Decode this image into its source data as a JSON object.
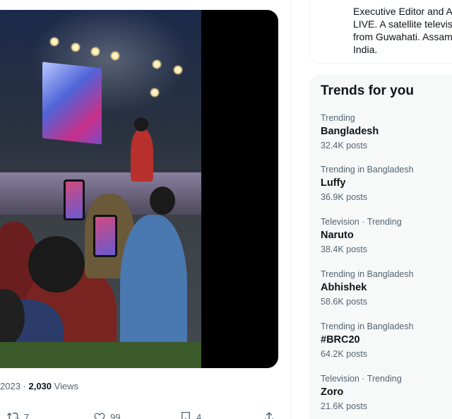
{
  "tweet": {
    "date_fragment": "2023",
    "separator": " · ",
    "views_count": "2,030",
    "views_label": " Views",
    "actions": {
      "retweet_count": "7",
      "like_count": "99",
      "bookmark_count": "4"
    }
  },
  "about": {
    "lines": "Executive Editor and A\nLIVE. A satellite televisi\nfrom Guwahati. Assam\nIndia."
  },
  "trends": {
    "title": "Trends for you",
    "items": [
      {
        "meta": "Trending",
        "name": "Bangladesh",
        "posts": "32.4K posts"
      },
      {
        "meta": "Trending in Bangladesh",
        "name": "Luffy",
        "posts": "36.9K posts"
      },
      {
        "meta": "Television · Trending",
        "name": "Naruto",
        "posts": "38.4K posts"
      },
      {
        "meta": "Trending in Bangladesh",
        "name": "Abhishek",
        "posts": "58.6K posts"
      },
      {
        "meta": "Trending in Bangladesh",
        "name": "#BRC20",
        "posts": "64.2K posts"
      },
      {
        "meta": "Television · Trending",
        "name": "Zoro",
        "posts": "21.6K posts"
      }
    ]
  },
  "colors": {
    "text_primary": "#0f1419",
    "text_secondary": "#536471",
    "panel_bg": "#f7f9f9",
    "border": "#eff3f4"
  }
}
